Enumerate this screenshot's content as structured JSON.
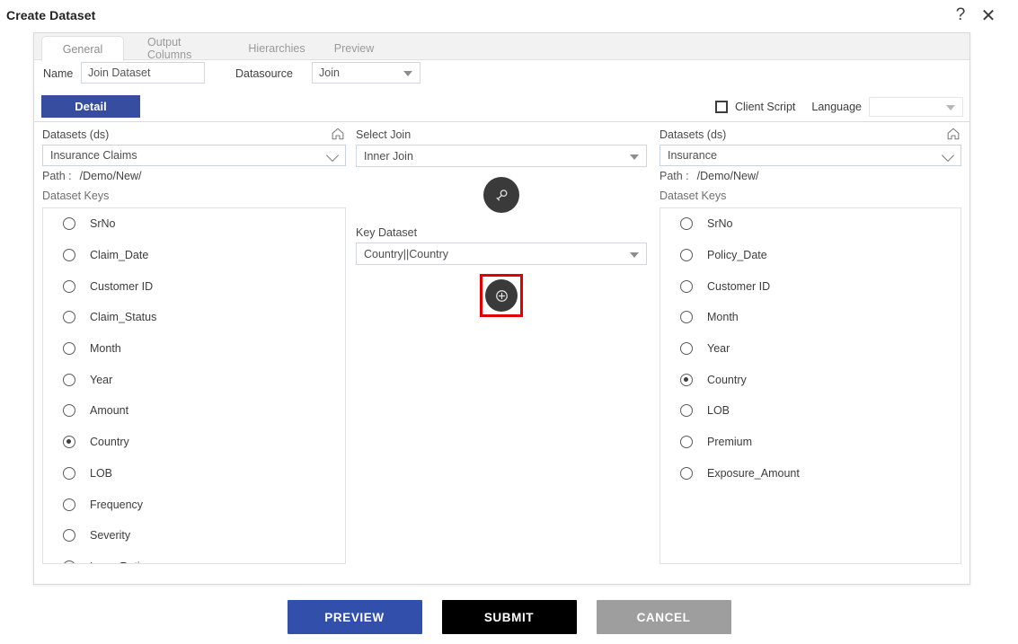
{
  "titlebar": {
    "title": "Create Dataset",
    "help_icon": "question-mark-icon",
    "help_label": "?",
    "close_icon": "close-x-icon",
    "close_label": "✕"
  },
  "tabs": [
    {
      "label": "General",
      "active": true
    },
    {
      "label": "Output Columns",
      "active": false
    },
    {
      "label": "Hierarchies",
      "active": false
    },
    {
      "label": "Preview",
      "active": false
    }
  ],
  "form": {
    "name_label": "Name",
    "name_value": "Join Dataset",
    "name_placeholder": "Name",
    "datasource_label": "Datasource",
    "datasource_value": "Join"
  },
  "detail": {
    "tab_label": "Detail",
    "client_script_label": "Client Script",
    "client_script_checked": false,
    "language_label": "Language",
    "language_value": ""
  },
  "left_panel": {
    "header": "Datasets (ds)",
    "home_icon": "home-icon",
    "dataset_value": "Insurance Claims",
    "path_label": "Path :",
    "path_value": "/Demo/New/",
    "keys_label": "Dataset Keys",
    "keys": [
      {
        "label": "SrNo",
        "selected": false
      },
      {
        "label": "Claim_Date",
        "selected": false
      },
      {
        "label": "Customer ID",
        "selected": false
      },
      {
        "label": "Claim_Status",
        "selected": false
      },
      {
        "label": "Month",
        "selected": false
      },
      {
        "label": "Year",
        "selected": false
      },
      {
        "label": "Amount",
        "selected": false
      },
      {
        "label": "Country",
        "selected": true
      },
      {
        "label": "LOB",
        "selected": false
      },
      {
        "label": "Frequency",
        "selected": false
      },
      {
        "label": "Severity",
        "selected": false
      },
      {
        "label": "Loss_Ratio",
        "selected": false
      }
    ]
  },
  "middle_panel": {
    "select_join_label": "Select Join",
    "select_join_value": "Inner Join",
    "key_icon": "key-icon",
    "key_dataset_label": "Key Dataset",
    "key_dataset_value": "Country||Country",
    "add_icon": "plus-circle-icon",
    "add_label": "⊕",
    "highlight_color": "#e00000"
  },
  "right_panel": {
    "header": "Datasets (ds)",
    "home_icon": "home-icon",
    "dataset_value": "Insurance",
    "path_label": "Path :",
    "path_value": "/Demo/New/",
    "keys_label": "Dataset Keys",
    "keys": [
      {
        "label": "SrNo",
        "selected": false
      },
      {
        "label": "Policy_Date",
        "selected": false
      },
      {
        "label": "Customer ID",
        "selected": false
      },
      {
        "label": "Month",
        "selected": false
      },
      {
        "label": "Year",
        "selected": false
      },
      {
        "label": "Country",
        "selected": true
      },
      {
        "label": "LOB",
        "selected": false
      },
      {
        "label": "Premium",
        "selected": false
      },
      {
        "label": "Exposure_Amount",
        "selected": false
      }
    ]
  },
  "footer": {
    "preview_label": "PREVIEW",
    "submit_label": "SUBMIT",
    "cancel_label": "CANCEL",
    "preview_color": "#3250ab",
    "submit_color": "#000000",
    "cancel_color": "#9e9e9e"
  }
}
